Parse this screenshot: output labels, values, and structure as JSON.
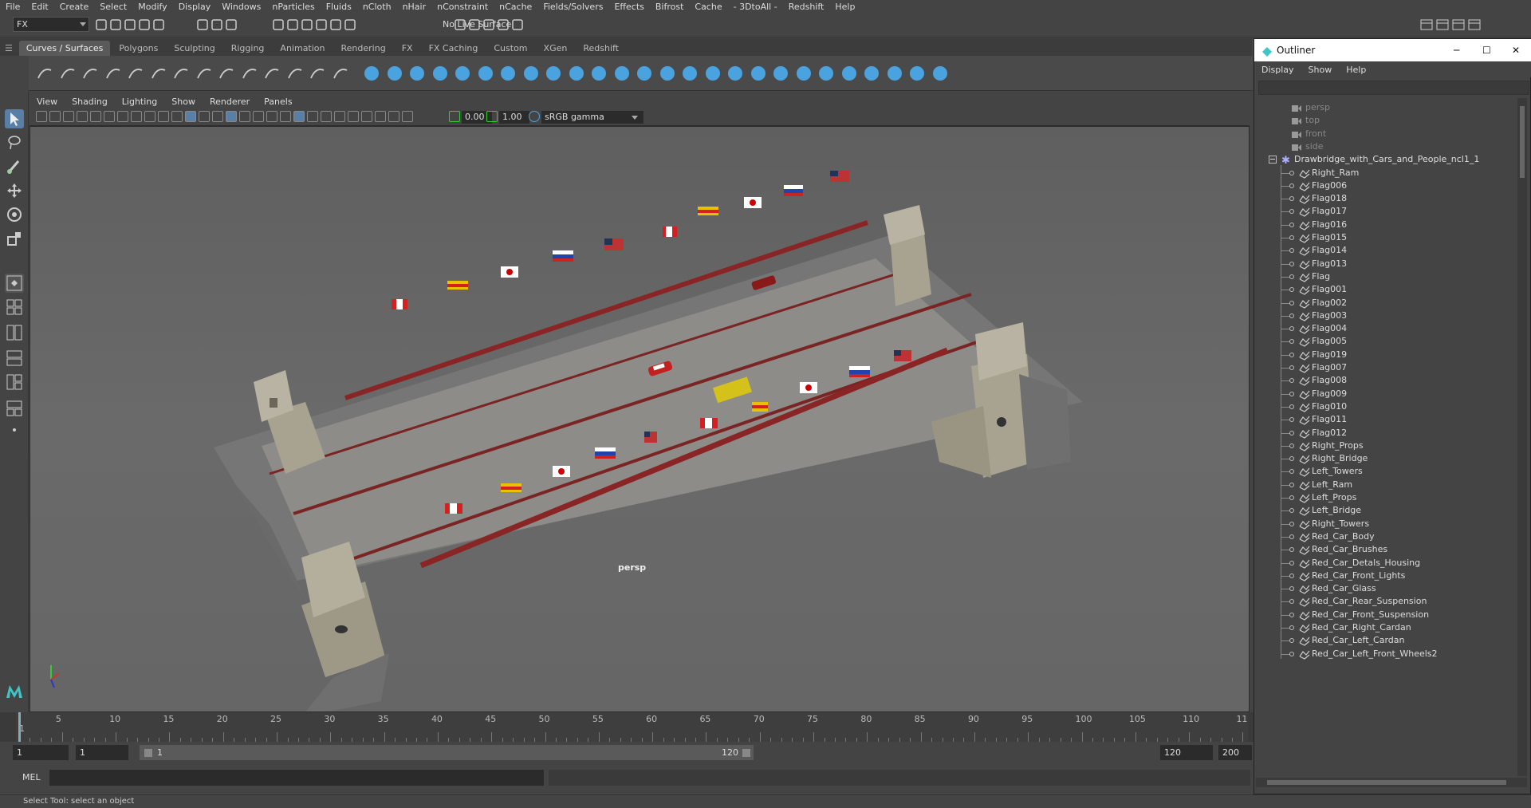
{
  "menubar": [
    "File",
    "Edit",
    "Create",
    "Select",
    "Modify",
    "Display",
    "Windows",
    "nParticles",
    "Fluids",
    "nCloth",
    "nHair",
    "nConstraint",
    "nCache",
    "Fields/Solvers",
    "Effects",
    "Bifrost",
    "Cache",
    "- 3DtoAll -",
    "Redshift",
    "Help"
  ],
  "toolbar": {
    "mode": "FX",
    "live_surface": "No Live Surface"
  },
  "shelf_tabs": [
    "Curves / Surfaces",
    "Polygons",
    "Sculpting",
    "Rigging",
    "Animation",
    "Rendering",
    "FX",
    "FX Caching",
    "Custom",
    "XGen",
    "Redshift"
  ],
  "panel_menu": [
    "View",
    "Shading",
    "Lighting",
    "Show",
    "Renderer",
    "Panels"
  ],
  "panel_toolbar": {
    "exposure": "0.00",
    "gamma": "1.00",
    "color_space": "sRGB gamma"
  },
  "viewport": {
    "camera_label": "persp"
  },
  "timeline": {
    "ticks": [
      "1",
      "5",
      "10",
      "15",
      "20",
      "25",
      "30",
      "35",
      "40",
      "45",
      "50",
      "55",
      "60",
      "65",
      "70",
      "75",
      "80",
      "85",
      "90",
      "95",
      "100",
      "105",
      "110",
      "11"
    ]
  },
  "range": {
    "start": "1",
    "current": "1",
    "slider_start": "1",
    "slider_end": "120",
    "end": "120",
    "max": "200"
  },
  "command": {
    "lang": "MEL"
  },
  "status": "Select Tool: select an object",
  "outliner": {
    "title": "Outliner",
    "menu": [
      "Display",
      "Show",
      "Help"
    ],
    "cameras": [
      "persp",
      "top",
      "front",
      "side"
    ],
    "root": "Drawbridge_with_Cars_and_People_ncl1_1",
    "items": [
      "Right_Ram",
      "Flag006",
      "Flag018",
      "Flag017",
      "Flag016",
      "Flag015",
      "Flag014",
      "Flag013",
      "Flag",
      "Flag001",
      "Flag002",
      "Flag003",
      "Flag004",
      "Flag005",
      "Flag019",
      "Flag007",
      "Flag008",
      "Flag009",
      "Flag010",
      "Flag011",
      "Flag012",
      "Right_Props",
      "Right_Bridge",
      "Left_Towers",
      "Left_Ram",
      "Left_Props",
      "Left_Bridge",
      "Right_Towers",
      "Red_Car_Body",
      "Red_Car_Brushes",
      "Red_Car_Detals_Housing",
      "Red_Car_Front_Lights",
      "Red_Car_Glass",
      "Red_Car_Rear_Suspension",
      "Red_Car_Front_Suspension",
      "Red_Car_Right_Cardan",
      "Red_Car_Left_Cardan",
      "Red_Car_Left_Front_Wheels2"
    ]
  }
}
